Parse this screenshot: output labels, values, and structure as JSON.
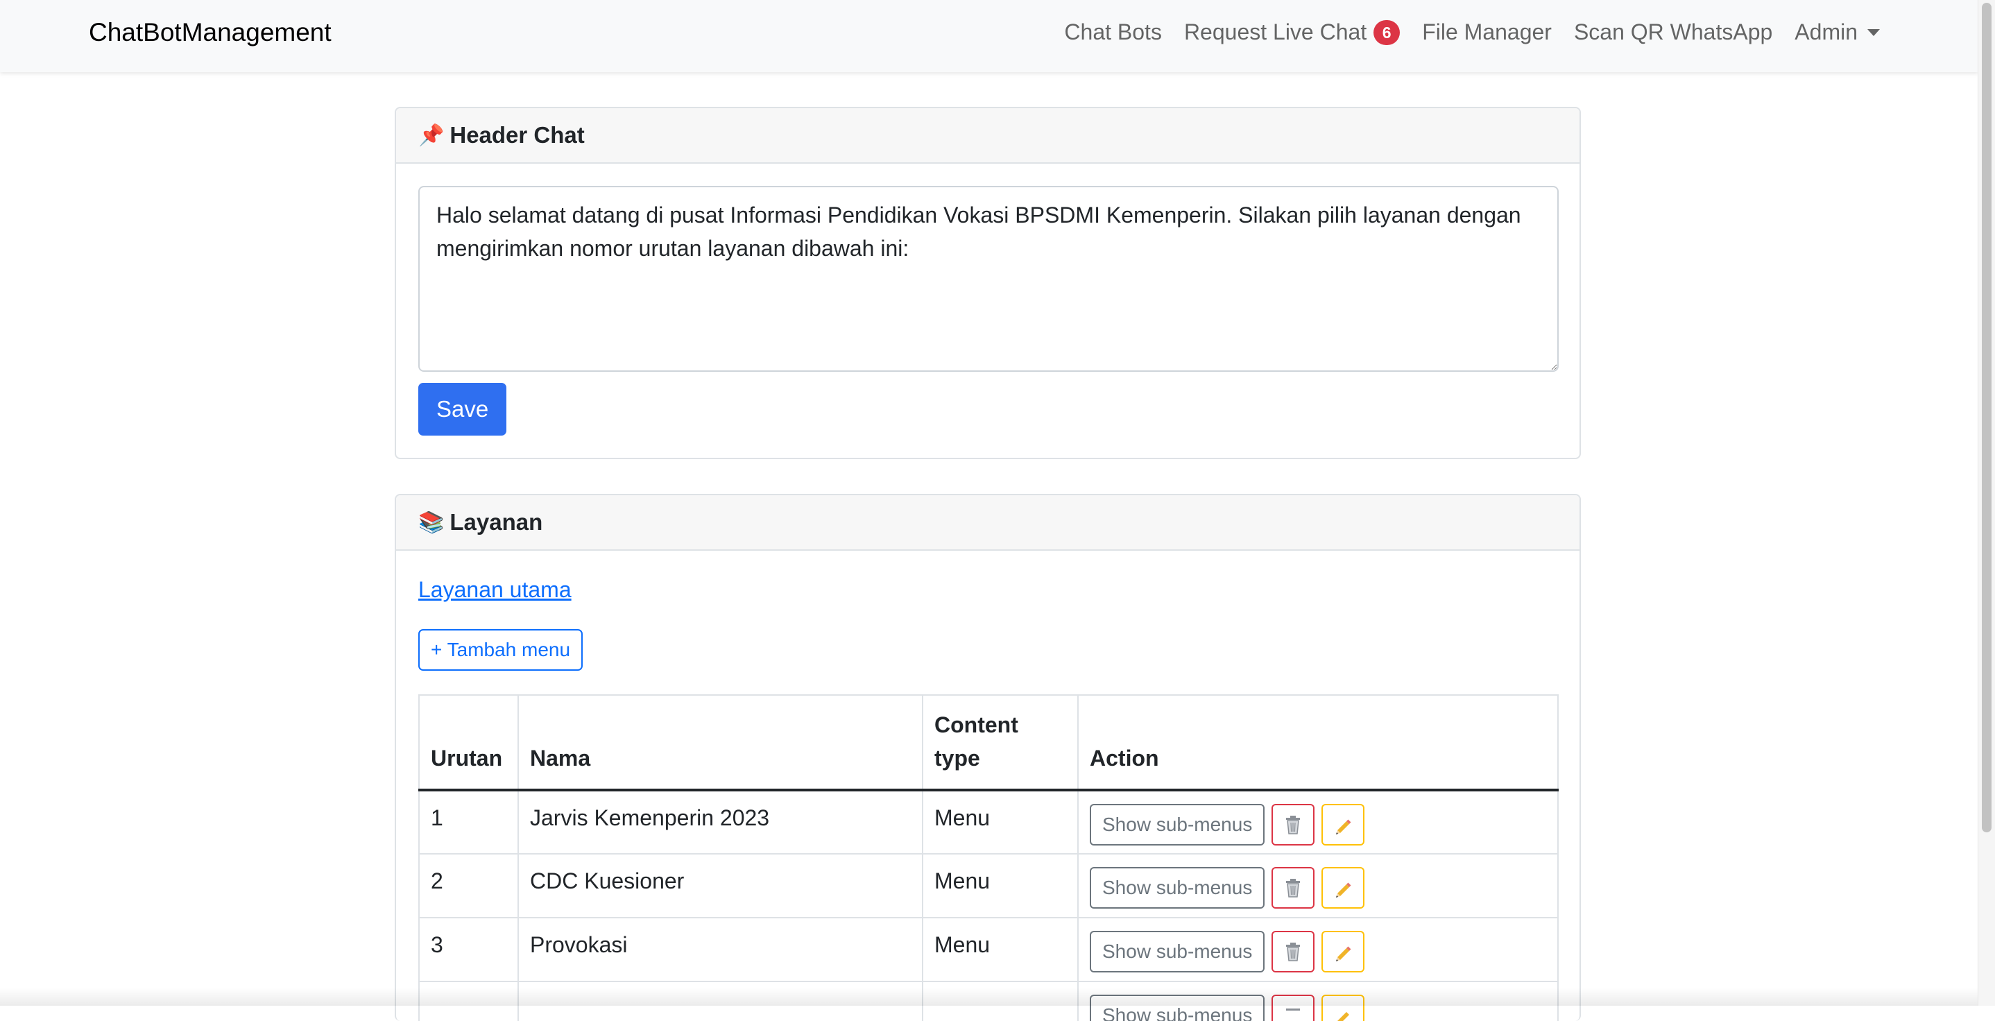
{
  "navbar": {
    "brand": "ChatBotManagement",
    "links": [
      {
        "label": "Chat Bots"
      },
      {
        "label": "Request Live Chat",
        "badge": "6"
      },
      {
        "label": "File Manager"
      },
      {
        "label": "Scan QR WhatsApp"
      },
      {
        "label": "Admin"
      }
    ]
  },
  "header_chat": {
    "icon": "pushpin-icon",
    "title": "Header Chat",
    "message": "Halo selamat datang di pusat Informasi Pendidikan Vokasi BPSDMI Kemenperin. Silakan pilih layanan dengan mengirimkan nomor urutan layanan dibawah ini:",
    "save_label": "Save"
  },
  "layanan": {
    "icon": "books-icon",
    "title": "Layanan",
    "breadcrumb": "Layanan utama",
    "add_label": "+ Tambah menu",
    "columns": {
      "urutan": "Urutan",
      "nama": "Nama",
      "content_type": "Content type",
      "action": "Action"
    },
    "rows": [
      {
        "urutan": "1",
        "nama": "Jarvis Kemenperin 2023",
        "content_type": "Menu"
      },
      {
        "urutan": "2",
        "nama": "CDC Kuesioner",
        "content_type": "Menu"
      },
      {
        "urutan": "3",
        "nama": "Provokasi",
        "content_type": "Menu"
      },
      {
        "urutan": "",
        "nama": "",
        "content_type": ""
      }
    ],
    "show_sub_label": "Show sub-menus"
  },
  "colors": {
    "primary": "#2f6ff0",
    "link": "#0d6efd",
    "danger": "#dc3545",
    "warning": "#ffc107",
    "navbar_bg": "#f8f9fa"
  }
}
